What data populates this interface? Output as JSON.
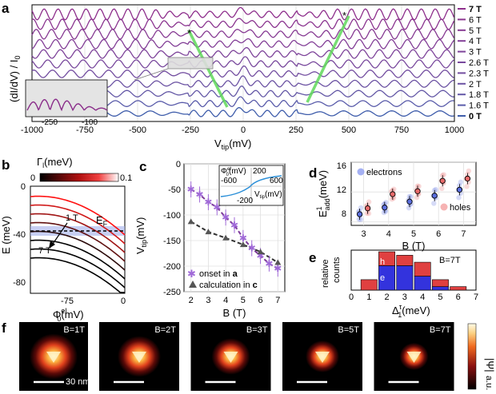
{
  "panels": {
    "a": {
      "label": "a",
      "ylabel": "(dI/dV) / I",
      "ylabel_sub": "0",
      "xlabel": "V",
      "xlabel_sub": "tip",
      "xlabel_unit": "(mV)",
      "xticks": [
        "-1000",
        "-750",
        "-500",
        "-250",
        "0",
        "250",
        "500",
        "750",
        "1000"
      ],
      "fields": [
        "7 T",
        "6 T",
        "5 T",
        "4 T",
        "3 T",
        "2.6 T",
        "2.3 T",
        "2 T",
        "1.8 T",
        "1.6 T",
        "0 T"
      ],
      "field_colors": [
        "#8e2f8c",
        "#8b3590",
        "#873b93",
        "#833f97",
        "#7e449a",
        "#79499d",
        "#734ea0",
        "#6c53a3",
        "#6458a6",
        "#5a5caa",
        "#3f5dab"
      ],
      "inset_xticks": [
        "-250",
        "-100"
      ],
      "star": "*"
    },
    "b": {
      "label": "b",
      "colorbar_title": "Γ",
      "colorbar_sub": "l",
      "colorbar_unit": "(meV)",
      "colorbar_min": "0",
      "colorbar_max": "0.1",
      "ylabel": "E (meV)",
      "yticks": [
        "0",
        "-40",
        "-80"
      ],
      "xlabel": "Φ",
      "xlabel_sup": "el",
      "xlabel_sub": "0",
      "xlabel_unit": "(mV)",
      "xticks": [
        "-75",
        "0"
      ],
      "ef_label": "E",
      "ef_sub": "F",
      "field_top": "1 T",
      "field_bottom": "7 T"
    },
    "c": {
      "label": "c",
      "ylabel": "V",
      "ylabel_sub": "tip",
      "ylabel_unit": "(mV)",
      "yticks": [
        "0",
        "-50",
        "-100",
        "-150",
        "-200",
        "-250"
      ],
      "xlabel": "B (T)",
      "xticks": [
        "2",
        "3",
        "4",
        "5",
        "6",
        "7"
      ],
      "legend_onset": "onset in ",
      "legend_onset_ref": "a",
      "legend_calc": "calculation in ",
      "legend_calc_ref": "c",
      "inset": {
        "ylabel": "Φ",
        "ylabel_sup": "el",
        "ylabel_sub": "0",
        "ylabel_unit": "(mV)",
        "tick_y_top": "200",
        "tick_y_bottom": "-200",
        "tick_x_left": "-600",
        "tick_x_right": "600",
        "xlabel": "V",
        "xlabel_sub": "tip",
        "xlabel_unit": "(mV)"
      }
    },
    "d": {
      "label": "d",
      "ylabel": "E",
      "ylabel_sup": "1",
      "ylabel_sub": "add",
      "ylabel_unit": "(meV)",
      "yticks": [
        "16",
        "12",
        "8"
      ],
      "xlabel": "B (T)",
      "xticks": [
        "3",
        "4",
        "5",
        "6",
        "7"
      ],
      "legend_electrons": "electrons",
      "legend_holes": "holes"
    },
    "e": {
      "label": "e",
      "ylabel_line1": "relative",
      "ylabel_line2": "counts",
      "xlabel": "Δ",
      "xlabel_sup": "τ",
      "xlabel_sub": "1",
      "xlabel_unit": "(meV)",
      "xticks": [
        "0",
        "1",
        "2",
        "3",
        "4",
        "5",
        "6",
        "7"
      ],
      "title": "B=7T",
      "label_h": "h",
      "label_e": "e"
    },
    "f": {
      "label": "f",
      "images": [
        "B=1T",
        "B=2T",
        "B=3T",
        "B=5T",
        "B=7T"
      ],
      "scalebar": "30 nm",
      "colorbar_label": "|Ψ|",
      "colorbar_unit": "a.u."
    }
  },
  "chart_data": [
    {
      "type": "line",
      "panel": "a",
      "xlabel": "Vtip (mV)",
      "ylabel": "(dI/dV) / I0",
      "xlim": [
        -1000,
        1000
      ],
      "series": [
        {
          "name": "7 T"
        },
        {
          "name": "6 T"
        },
        {
          "name": "5 T"
        },
        {
          "name": "4 T"
        },
        {
          "name": "3 T"
        },
        {
          "name": "2.6 T"
        },
        {
          "name": "2.3 T"
        },
        {
          "name": "2 T"
        },
        {
          "name": "1.8 T"
        },
        {
          "name": "1.6 T"
        },
        {
          "name": "0 T"
        }
      ]
    },
    {
      "type": "scatter",
      "panel": "c",
      "xlabel": "B (T)",
      "ylabel": "Vtip (mV)",
      "xlim": [
        1.6,
        7.4
      ],
      "ylim": [
        -250,
        0
      ],
      "series": [
        {
          "name": "onset in a",
          "x": [
            2,
            2.5,
            3,
            3.5,
            4,
            4.5,
            5,
            5.5,
            6,
            6.5,
            7
          ],
          "y": [
            -50,
            -60,
            -75,
            -85,
            -105,
            -120,
            -145,
            -165,
            -180,
            -195,
            -205
          ]
        },
        {
          "name": "calculation in c",
          "x": [
            2,
            3,
            4,
            5,
            6,
            7
          ],
          "y": [
            -113,
            -133,
            -145,
            -158,
            -172,
            -193
          ]
        }
      ]
    },
    {
      "type": "scatter",
      "panel": "d",
      "xlabel": "B (T)",
      "ylabel": "E1add (meV)",
      "xlim": [
        2.5,
        7.5
      ],
      "ylim": [
        7.5,
        16
      ],
      "series": [
        {
          "name": "electrons",
          "x": [
            3,
            4,
            5,
            6,
            7
          ],
          "y": [
            9.0,
            9.9,
            10.7,
            11.5,
            12.3
          ]
        },
        {
          "name": "holes",
          "x": [
            3,
            4,
            5,
            6,
            7
          ],
          "y": [
            9.8,
            11.7,
            12.1,
            13.5,
            13.8
          ]
        }
      ]
    },
    {
      "type": "bar",
      "panel": "e",
      "title": "B=7T",
      "xlabel": "Δτ1 (meV)",
      "ylabel": "relative counts",
      "xlim": [
        0,
        7
      ],
      "bins": [
        1,
        2,
        3,
        4,
        5,
        6
      ],
      "series": [
        {
          "name": "h",
          "values": [
            3,
            4,
            3,
            4,
            2,
            1
          ]
        },
        {
          "name": "e",
          "values": [
            0,
            7,
            7,
            4,
            1,
            0
          ]
        }
      ]
    }
  ]
}
